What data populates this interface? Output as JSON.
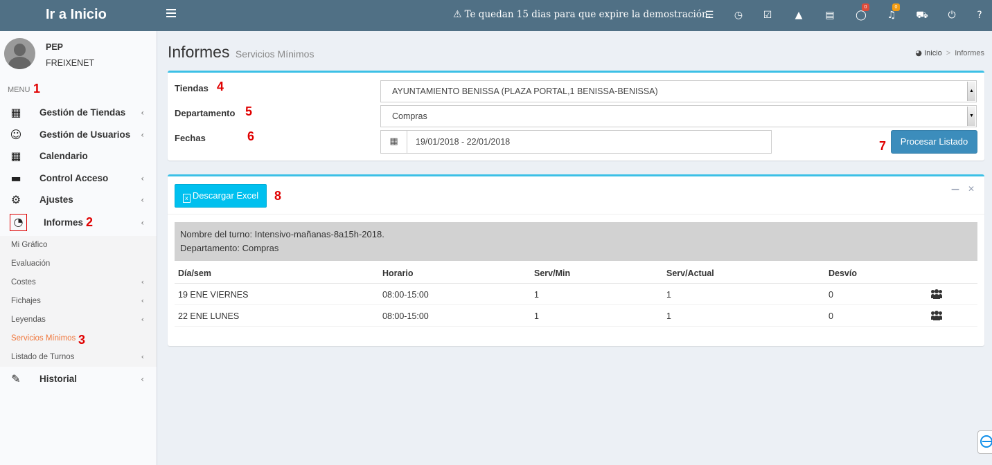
{
  "header": {
    "brand": "Ir a Inicio",
    "warning": "Te quedan 15 dias para que expire la demostración.",
    "icons": [
      {
        "name": "list-icon",
        "glyph": "☰"
      },
      {
        "name": "clock-icon",
        "glyph": "◷"
      },
      {
        "name": "calendar-check-icon",
        "glyph": "☑"
      },
      {
        "name": "road-icon",
        "glyph": "▲"
      },
      {
        "name": "newspaper-icon",
        "glyph": "▤"
      },
      {
        "name": "chat-icon",
        "glyph": "◯",
        "badge": "0",
        "badge_color": "#dd4b39"
      },
      {
        "name": "bell-icon",
        "glyph": "♫",
        "badge": "0",
        "badge_color": "#f39c12"
      },
      {
        "name": "cart-icon",
        "glyph": "⛟"
      },
      {
        "name": "power-icon",
        "glyph": "⏻"
      },
      {
        "name": "help-icon",
        "glyph": "?"
      }
    ]
  },
  "user": {
    "first": "PEP",
    "last": "FREIXENET"
  },
  "sidebar": {
    "menu_header": "MENU",
    "items": [
      {
        "label": "Gestión de Tiendas",
        "icon": "building-icon",
        "has_chevron": true
      },
      {
        "label": "Gestión de Usuarios",
        "icon": "smile-icon",
        "has_chevron": true
      },
      {
        "label": "Calendario",
        "icon": "calendar-icon",
        "has_chevron": false
      },
      {
        "label": "Control Acceso",
        "icon": "credit-card-icon",
        "has_chevron": true
      },
      {
        "label": "Ajustes",
        "icon": "gear-icon",
        "has_chevron": true
      },
      {
        "label": "Informes",
        "icon": "pie-chart-icon",
        "has_chevron": true
      }
    ],
    "subitems": [
      {
        "label": "Mi Gráfico",
        "has_chevron": false,
        "active": false
      },
      {
        "label": "Evaluación",
        "has_chevron": false,
        "active": false
      },
      {
        "label": "Costes",
        "has_chevron": true,
        "active": false
      },
      {
        "label": "Fichajes",
        "has_chevron": true,
        "active": false
      },
      {
        "label": "Leyendas",
        "has_chevron": true,
        "active": false
      },
      {
        "label": "Servicios Mínimos",
        "has_chevron": false,
        "active": true
      },
      {
        "label": "Listado de Turnos",
        "has_chevron": true,
        "active": false
      }
    ],
    "last_item": {
      "label": "Historial",
      "icon": "edit-icon",
      "has_chevron": true
    },
    "active_color": "#f0763b"
  },
  "page": {
    "title": "Informes",
    "subtitle": "Servicios Mínimos",
    "breadcrumb_home": "Inicio",
    "breadcrumb_current": "Informes"
  },
  "filters": {
    "tiendas_label": "Tiendas",
    "tiendas_value": "AYUNTAMIENTO BENISSA (PLAZA PORTAL,1 BENISSA-BENISSA)",
    "departamento_label": "Departamento",
    "departamento_value": "Compras",
    "fechas_label": "Fechas",
    "fechas_value": "19/01/2018 - 22/01/2018",
    "submit_label": "Procesar Listado"
  },
  "results": {
    "excel_label": "Descargar Excel",
    "turno_line": "Nombre del turno: Intensivo-mañanas-8a15h-2018.",
    "departamento_line": "Departamento: Compras",
    "columns": [
      "Día/sem",
      "Horario",
      "Serv/Min",
      "Serv/Actual",
      "Desvío"
    ],
    "rows": [
      [
        "19 ENE VIERNES",
        "08:00-15:00",
        "1",
        "1",
        "0"
      ],
      [
        "22 ENE LUNES",
        "08:00-15:00",
        "1",
        "1",
        "0"
      ]
    ]
  },
  "annotations": [
    "1",
    "2",
    "3",
    "4",
    "5",
    "6",
    "7",
    "8"
  ],
  "colors": {
    "header_bg": "#507085",
    "accent": "#3cc0e6",
    "primary": "#3c8dbc",
    "info_btn": "#00c0ef",
    "annotation": "#e00000"
  }
}
